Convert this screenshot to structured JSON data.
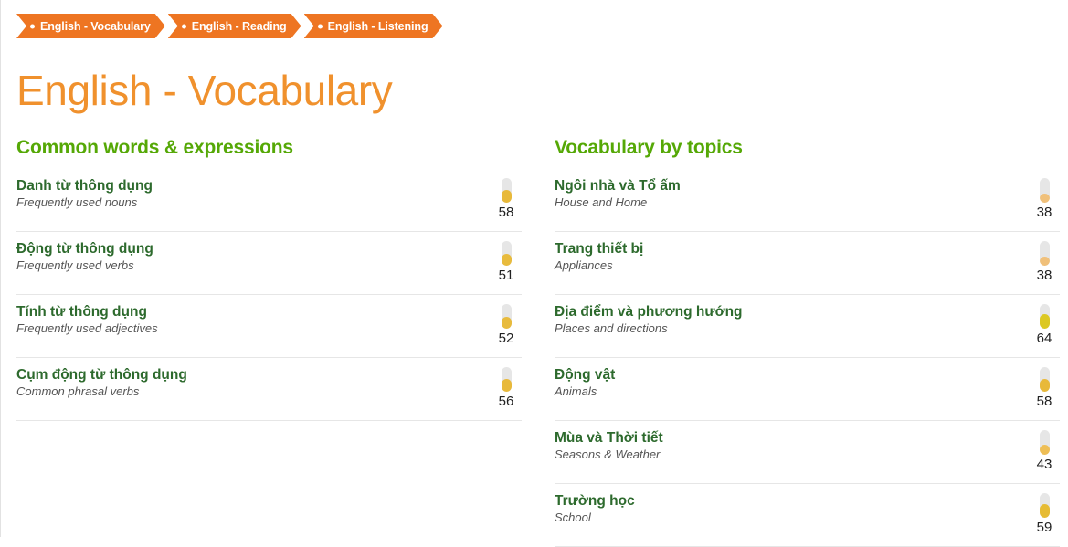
{
  "theme": {
    "tab_bg": "#ee7522",
    "title_color": "#f0912d",
    "heading_color": "#55a806",
    "item_title_color": "#2d6a2d",
    "meter_track": "#e6e6e6"
  },
  "tabs": [
    {
      "label": "English - Vocabulary",
      "icon": "bullet-dot-icon",
      "active": true
    },
    {
      "label": "English - Reading",
      "icon": "bullet-dot-icon",
      "active": false
    },
    {
      "label": "English - Listening",
      "icon": "bullet-dot-icon",
      "active": false
    }
  ],
  "page_title": "English - Vocabulary",
  "columns": [
    {
      "heading": "Common words & expressions",
      "items": [
        {
          "title": "Danh từ thông dụng",
          "subtitle": "Frequently used nouns",
          "count": "58",
          "fill_pct": 52,
          "fill_color": "#e8b93a"
        },
        {
          "title": "Động từ thông dụng",
          "subtitle": "Frequently used verbs",
          "count": "51",
          "fill_pct": 48,
          "fill_color": "#e8bb3d"
        },
        {
          "title": "Tính từ thông dụng",
          "subtitle": "Frequently used adjectives",
          "count": "52",
          "fill_pct": 49,
          "fill_color": "#e8bb3d"
        },
        {
          "title": "Cụm động từ thông dụng",
          "subtitle": "Common phrasal verbs",
          "count": "56",
          "fill_pct": 51,
          "fill_color": "#e8b93a"
        }
      ]
    },
    {
      "heading": "Vocabulary by topics",
      "items": [
        {
          "title": "Ngôi nhà và Tổ ấm",
          "subtitle": "House and Home",
          "count": "38",
          "fill_pct": 38,
          "fill_color": "#f0c07a"
        },
        {
          "title": "Trang thiết bị",
          "subtitle": "Appliances",
          "count": "38",
          "fill_pct": 38,
          "fill_color": "#f0c07a"
        },
        {
          "title": "Địa điểm và phương hướng",
          "subtitle": "Places and directions",
          "count": "64",
          "fill_pct": 60,
          "fill_color": "#dcc822"
        },
        {
          "title": "Động vật",
          "subtitle": "Animals",
          "count": "58",
          "fill_pct": 52,
          "fill_color": "#e8b93a"
        },
        {
          "title": "Mùa và Thời tiết",
          "subtitle": "Seasons & Weather",
          "count": "43",
          "fill_pct": 42,
          "fill_color": "#eebe55"
        },
        {
          "title": "Trường học",
          "subtitle": "School",
          "count": "59",
          "fill_pct": 54,
          "fill_color": "#e6bb33"
        }
      ]
    }
  ]
}
